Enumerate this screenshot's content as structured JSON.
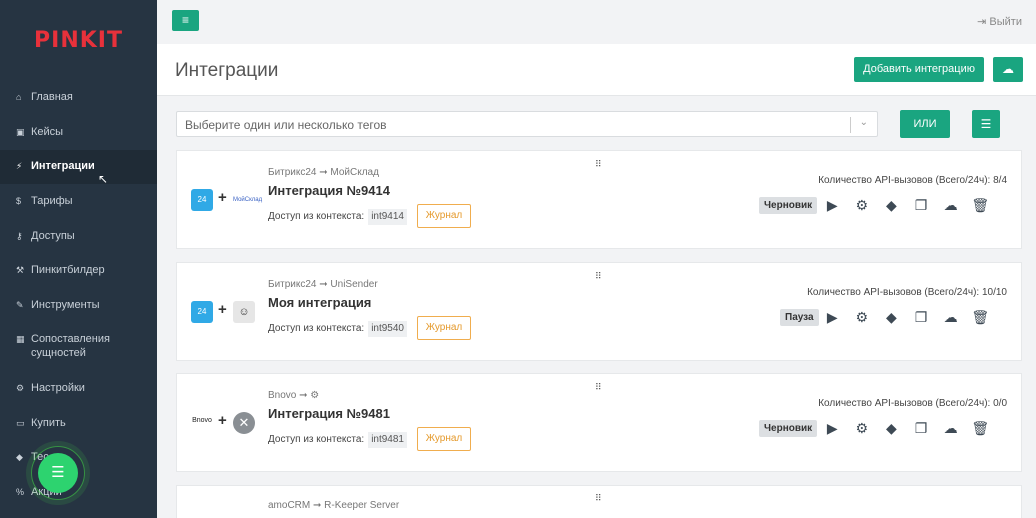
{
  "sidebar": {
    "logo": "PINKIT",
    "items": [
      {
        "label": "Главная",
        "icon": "home-icon",
        "glyph": "⌂",
        "name": "sidebar-item-main"
      },
      {
        "label": "Кейсы",
        "icon": "briefcase-icon",
        "glyph": "▣",
        "name": "sidebar-item-cases"
      },
      {
        "label": "Интеграции",
        "icon": "plug-icon",
        "glyph": "⚡",
        "name": "sidebar-item-integrations"
      },
      {
        "label": "Тарифы",
        "icon": "dollar-icon",
        "glyph": "$",
        "name": "sidebar-item-tariffs"
      },
      {
        "label": "Доступы",
        "icon": "key-icon",
        "glyph": "⚷",
        "name": "sidebar-item-access"
      },
      {
        "label": "Пинкитбилдер",
        "icon": "hammer-icon",
        "glyph": "⚒",
        "name": "sidebar-item-builder"
      },
      {
        "label": "Инструменты",
        "icon": "wrench-icon",
        "glyph": "✎",
        "name": "sidebar-item-tools"
      },
      {
        "label": "Сопоставления сущностей",
        "icon": "table-icon",
        "glyph": "▦",
        "name": "sidebar-item-mappings"
      },
      {
        "label": "Настройки",
        "icon": "gears-icon",
        "glyph": "⚙",
        "name": "sidebar-item-settings"
      },
      {
        "label": "Купить",
        "icon": "ticket-icon",
        "glyph": "▭",
        "name": "sidebar-item-buy"
      },
      {
        "label": "Тес",
        "icon": "tags-icon",
        "glyph": "◆",
        "name": "sidebar-item-tests"
      },
      {
        "label": "Акции",
        "icon": "percent-icon",
        "glyph": "%",
        "name": "sidebar-item-promos"
      }
    ]
  },
  "topbar": {
    "menu_icon": "≡",
    "logout_label": "Выйти",
    "logout_icon": "⇥"
  },
  "header": {
    "title": "Интеграции",
    "add_label": "Добавить интеграцию",
    "cloud_icon": "☁"
  },
  "filter": {
    "placeholder": "Выберите один или несколько тегов",
    "chevron": "⌄",
    "or_label": "ИЛИ",
    "list_icon": "☰"
  },
  "cards": [
    {
      "route": "Битрикс24 ➞ МойСклад",
      "title": "Интеграция №9414",
      "ctx_label": "Доступ из контекста:",
      "code": "int9414",
      "journal": "Журнал",
      "calls": "Количество API-вызовов (Всего/24ч): 8/4",
      "status": "Черновик",
      "logo1": "24",
      "logo2": "МойСклад"
    },
    {
      "route": "Битрикс24 ➞ UniSender",
      "title": "Моя интеграция",
      "ctx_label": "Доступ из контекста:",
      "code": "int9540",
      "journal": "Журнал",
      "calls": "Количество API-вызовов (Всего/24ч): 10/10",
      "status": "Пауза",
      "logo1": "24",
      "logo2": "☺"
    },
    {
      "route": "Bnovo ➞ ⚙",
      "title": "Интеграция №9481",
      "ctx_label": "Доступ из контекста:",
      "code": "int9481",
      "journal": "Журнал",
      "calls": "Количество API-вызовов (Всего/24ч): 0/0",
      "status": "Черновик",
      "logo1": "Bnovo",
      "logo2": "✕"
    }
  ],
  "partial_card": {
    "route": "amoCRM ➞ R-Keeper Server"
  },
  "actions": [
    "▶",
    "⚙",
    "◆",
    "❐",
    "☁",
    "🗑"
  ],
  "grip_icon": "⠿",
  "fab_icon": "☰",
  "colors": {
    "accent": "#1aa580",
    "sidebar": "#263442",
    "brand": "#e8313b",
    "journal": "#f0ad4e"
  }
}
